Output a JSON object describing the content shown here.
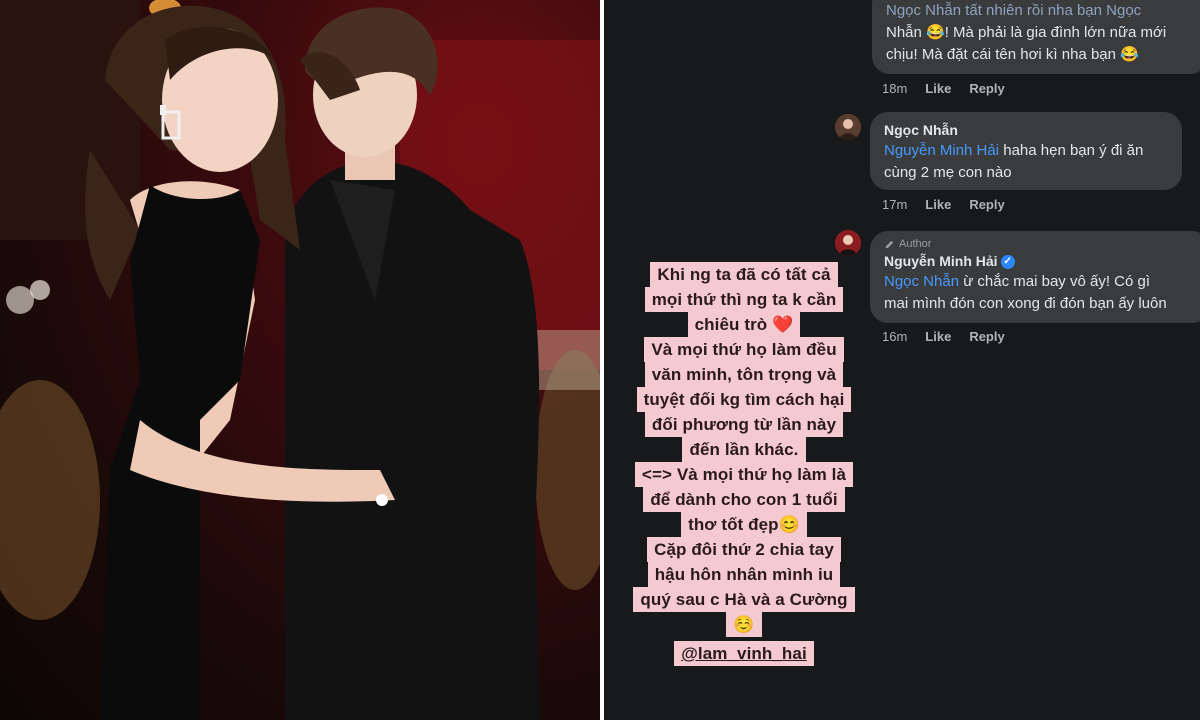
{
  "comments": [
    {
      "line1": "Ngọc Nhẫn tất nhiên rồi nha bạn Ngọc",
      "line2": "Nhẫn 😂! Mà phải là gia đình lớn nữa mới",
      "line3": "chịu! Mà đặt cái tên hơi kì nha bạn 😂",
      "time": "18m",
      "like": "Like",
      "reply": "Reply"
    },
    {
      "name": "Ngọc Nhẫn",
      "mention": "Nguyễn Minh Hải",
      "line1": " haha hẹn bạn ý đi ăn",
      "line2": "cùng 2 mẹ con nào",
      "time": "17m",
      "like": "Like",
      "reply": "Reply"
    },
    {
      "author_tag": "Author",
      "name": "Nguyễn Minh Hải",
      "mention": "Ngọc Nhẫn",
      "line1": " ừ chắc mai bay vô ấy! Có gì",
      "line2": "mai mình đón con xong đi đón bạn ấy luôn",
      "time": "16m",
      "like": "Like",
      "reply": "Reply"
    }
  ],
  "story_lines": [
    "Khi ng ta đã có tất cả",
    "mọi thứ thì ng ta k cần",
    "chiêu trò ❤️",
    "Và mọi thứ họ làm đều",
    "văn minh, tôn trọng và",
    "tuyệt đối kg tìm cách hại",
    "đối phương từ lần này",
    "đến lần khác.",
    "<=> Và mọi thứ họ làm là",
    "để dành cho con 1 tuổi",
    "thơ tốt đẹp😊",
    "Cặp đôi thứ 2 chia tay",
    "hậu hôn nhân mình iu",
    "quý sau c Hà và a Cường",
    "☺️"
  ],
  "story_tag": "@lam_vinh_hai",
  "colors": {
    "dark_bg": "#18191a",
    "bubble_bg": "#3a3b3c",
    "mention_blue": "#4599ff",
    "story_highlight": "#f4c9cf"
  }
}
